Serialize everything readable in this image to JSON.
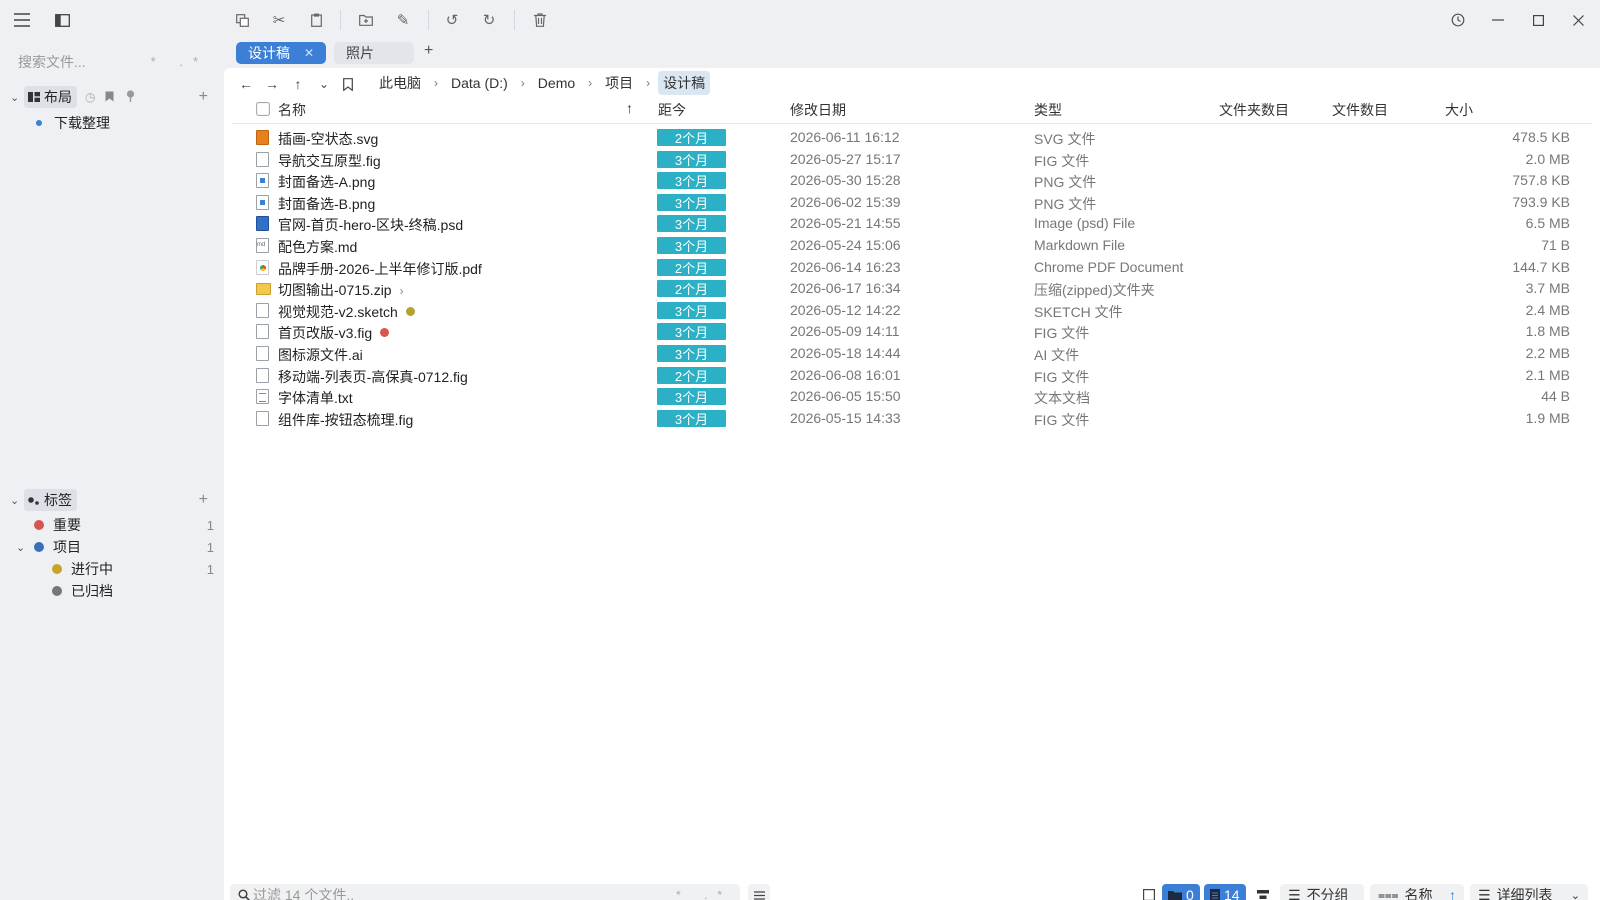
{
  "toolbar": {
    "icons": [
      "menu-icon",
      "sidebar-toggle-icon",
      "copy-icon",
      "cut-icon",
      "paste-icon",
      "new-folder-icon",
      "rename-icon",
      "undo-icon",
      "redo-icon",
      "delete-icon",
      "history-icon",
      "minimize-icon",
      "maximize-icon",
      "close-icon"
    ]
  },
  "sidebar": {
    "search_placeholder": "搜索文件...",
    "search_tail": "* .*",
    "layout_label": "布局",
    "layout_items": [
      {
        "label": "下载整理"
      }
    ],
    "tags_label": "标签",
    "tags": [
      {
        "label": "重要",
        "count": "1",
        "color": "#d9534f"
      },
      {
        "label": "项目",
        "count": "1",
        "color": "#3b6fb6"
      },
      {
        "label": "进行中",
        "count": "1",
        "color": "#c9a227"
      },
      {
        "label": "已归档",
        "count": "",
        "color": "#777777"
      }
    ]
  },
  "tabs": [
    {
      "label": "设计稿",
      "active": true,
      "close": "✕"
    },
    {
      "label": "照片",
      "active": false
    }
  ],
  "tab_add": "+",
  "breadcrumb": [
    "此电脑",
    "Data (D:)",
    "Demo",
    "项目",
    "设计稿"
  ],
  "columns": {
    "name": "名称",
    "age": "距今",
    "modified": "修改日期",
    "type": "类型",
    "folder_count": "文件夹数目",
    "file_count": "文件数目",
    "size": "大小"
  },
  "files": [
    {
      "name": "插画-空状态.svg",
      "age": "2个月",
      "date": "2026-06-11 16:12",
      "type": "SVG 文件",
      "size": "478.5 KB",
      "icon": "svg"
    },
    {
      "name": "导航交互原型.fig",
      "age": "3个月",
      "date": "2026-05-27 15:17",
      "type": "FIG 文件",
      "size": "2.0 MB",
      "icon": "doc"
    },
    {
      "name": "封面备选-A.png",
      "age": "3个月",
      "date": "2026-05-30 15:28",
      "type": "PNG 文件",
      "size": "757.8 KB",
      "icon": "img"
    },
    {
      "name": "封面备选-B.png",
      "age": "3个月",
      "date": "2026-06-02 15:39",
      "type": "PNG 文件",
      "size": "793.9 KB",
      "icon": "img"
    },
    {
      "name": "官网-首页-hero-区块-终稿.psd",
      "age": "3个月",
      "date": "2026-05-21 14:55",
      "type": "Image (psd) File",
      "size": "6.5 MB",
      "icon": "psd"
    },
    {
      "name": "配色方案.md",
      "age": "3个月",
      "date": "2026-05-24 15:06",
      "type": "Markdown File",
      "size": "71 B",
      "icon": "md"
    },
    {
      "name": "品牌手册-2026-上半年修订版.pdf",
      "age": "2个月",
      "date": "2026-06-14 16:23",
      "type": "Chrome PDF Document",
      "size": "144.7 KB",
      "icon": "pdf"
    },
    {
      "name": "切图输出-0715.zip",
      "age": "2个月",
      "date": "2026-06-17 16:34",
      "type": "压缩(zipped)文件夹",
      "size": "3.7 MB",
      "icon": "zip",
      "expand": true
    },
    {
      "name": "视觉规范-v2.sketch",
      "age": "3个月",
      "date": "2026-05-12 14:22",
      "type": "SKETCH 文件",
      "size": "2.4 MB",
      "icon": "doc",
      "tag": "#b5a032"
    },
    {
      "name": "首页改版-v3.fig",
      "age": "3个月",
      "date": "2026-05-09 14:11",
      "type": "FIG 文件",
      "size": "1.8 MB",
      "icon": "doc",
      "tag": "#d9534f"
    },
    {
      "name": "图标源文件.ai",
      "age": "3个月",
      "date": "2026-05-18 14:44",
      "type": "AI 文件",
      "size": "2.2 MB",
      "icon": "doc"
    },
    {
      "name": "移动端-列表页-高保真-0712.fig",
      "age": "2个月",
      "date": "2026-06-08 16:01",
      "type": "FIG 文件",
      "size": "2.1 MB",
      "icon": "doc"
    },
    {
      "name": "字体清单.txt",
      "age": "3个月",
      "date": "2026-06-05 15:50",
      "type": "文本文档",
      "size": "44 B",
      "icon": "txt"
    },
    {
      "name": "组件库-按钮态梳理.fig",
      "age": "3个月",
      "date": "2026-05-15 14:33",
      "type": "FIG 文件",
      "size": "1.9 MB",
      "icon": "doc"
    }
  ],
  "bottom": {
    "filter_placeholder": "过滤 14 个文件..",
    "filter_tail": "* .*",
    "folder_count": "0",
    "file_count": "14",
    "group_label": "不分组",
    "sort_label": "名称",
    "view_label": "详细列表"
  }
}
